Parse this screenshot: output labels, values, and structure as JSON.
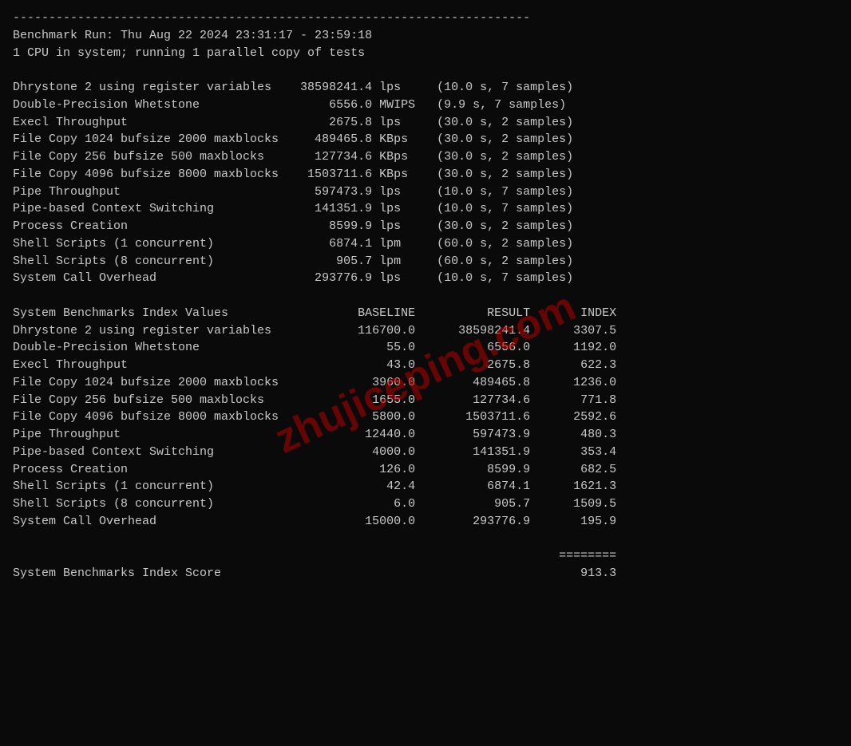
{
  "divider": "------------------------------------------------------------------------",
  "benchmark_run": {
    "line1": "Benchmark Run: Thu Aug 22 2024 23:31:17 - 23:59:18",
    "line2": "1 CPU in system; running 1 parallel copy of tests"
  },
  "results": [
    {
      "name": "Dhrystone 2 using register variables",
      "value": "38598241.4",
      "unit": "lps  ",
      "detail": "(10.0 s, 7 samples)"
    },
    {
      "name": "Double-Precision Whetstone",
      "value": "6556.0",
      "unit": "MWIPS",
      "detail": "(9.9 s, 7 samples)"
    },
    {
      "name": "Execl Throughput",
      "value": "2675.8",
      "unit": "lps  ",
      "detail": "(30.0 s, 2 samples)"
    },
    {
      "name": "File Copy 1024 bufsize 2000 maxblocks",
      "value": "489465.8",
      "unit": "KBps ",
      "detail": "(30.0 s, 2 samples)"
    },
    {
      "name": "File Copy 256 bufsize 500 maxblocks",
      "value": "127734.6",
      "unit": "KBps ",
      "detail": "(30.0 s, 2 samples)"
    },
    {
      "name": "File Copy 4096 bufsize 8000 maxblocks",
      "value": "1503711.6",
      "unit": "KBps ",
      "detail": "(30.0 s, 2 samples)"
    },
    {
      "name": "Pipe Throughput",
      "value": "597473.9",
      "unit": "lps  ",
      "detail": "(10.0 s, 7 samples)"
    },
    {
      "name": "Pipe-based Context Switching",
      "value": "141351.9",
      "unit": "lps  ",
      "detail": "(10.0 s, 7 samples)"
    },
    {
      "name": "Process Creation",
      "value": "8599.9",
      "unit": "lps  ",
      "detail": "(30.0 s, 2 samples)"
    },
    {
      "name": "Shell Scripts (1 concurrent)",
      "value": "6874.1",
      "unit": "lpm  ",
      "detail": "(60.0 s, 2 samples)"
    },
    {
      "name": "Shell Scripts (8 concurrent)",
      "value": "905.7",
      "unit": "lpm  ",
      "detail": "(60.0 s, 2 samples)"
    },
    {
      "name": "System Call Overhead",
      "value": "293776.9",
      "unit": "lps  ",
      "detail": "(10.0 s, 7 samples)"
    }
  ],
  "index_header": {
    "title": "System Benchmarks Index Values",
    "col_baseline": "BASELINE",
    "col_result": "RESULT",
    "col_index": "INDEX"
  },
  "index_rows": [
    {
      "name": "Dhrystone 2 using register variables",
      "baseline": "116700.0",
      "result": "38598241.4",
      "index": "3307.5"
    },
    {
      "name": "Double-Precision Whetstone",
      "baseline": "55.0",
      "result": "6556.0",
      "index": "1192.0"
    },
    {
      "name": "Execl Throughput",
      "baseline": "43.0",
      "result": "2675.8",
      "index": "622.3"
    },
    {
      "name": "File Copy 1024 bufsize 2000 maxblocks",
      "baseline": "3960.0",
      "result": "489465.8",
      "index": "1236.0"
    },
    {
      "name": "File Copy 256 bufsize 500 maxblocks",
      "baseline": "1655.0",
      "result": "127734.6",
      "index": "771.8"
    },
    {
      "name": "File Copy 4096 bufsize 8000 maxblocks",
      "baseline": "5800.0",
      "result": "1503711.6",
      "index": "2592.6"
    },
    {
      "name": "Pipe Throughput",
      "baseline": "12440.0",
      "result": "597473.9",
      "index": "480.3"
    },
    {
      "name": "Pipe-based Context Switching",
      "baseline": "4000.0",
      "result": "141351.9",
      "index": "353.4"
    },
    {
      "name": "Process Creation",
      "baseline": "126.0",
      "result": "8599.9",
      "index": "682.5"
    },
    {
      "name": "Shell Scripts (1 concurrent)",
      "baseline": "42.4",
      "result": "6874.1",
      "index": "1621.3"
    },
    {
      "name": "Shell Scripts (8 concurrent)",
      "baseline": "6.0",
      "result": "905.7",
      "index": "1509.5"
    },
    {
      "name": "System Call Overhead",
      "baseline": "15000.0",
      "result": "293776.9",
      "index": "195.9"
    }
  ],
  "equals_line": "========",
  "final_score": {
    "label": "System Benchmarks Index Score",
    "value": "913.3"
  },
  "watermark": "zhujiceping.com"
}
